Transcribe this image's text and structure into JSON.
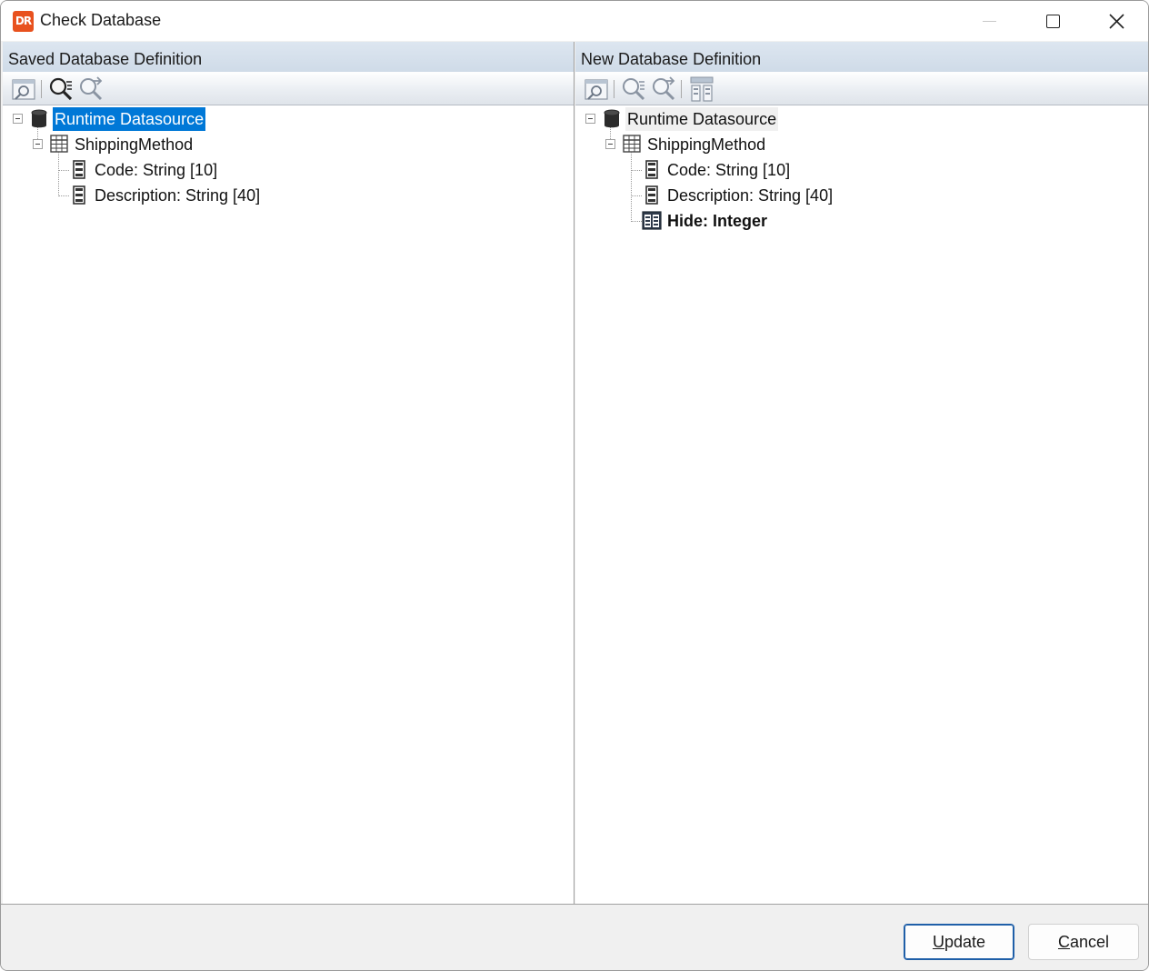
{
  "window": {
    "title": "Check Database",
    "app_icon_text": "DR",
    "controls": [
      "minimize-icon",
      "maximize-icon",
      "close-icon"
    ]
  },
  "left_pane": {
    "header": "Saved Database Definition",
    "toolbar": [
      "view-definition-icon",
      "find-icon",
      "find-next-icon"
    ],
    "tree": {
      "root": {
        "label": "Runtime Datasource",
        "icon": "database-icon",
        "state": "selected"
      },
      "table": {
        "label": "ShippingMethod",
        "icon": "table-icon"
      },
      "fields": [
        {
          "label": "Code: String [10]",
          "icon": "field-icon"
        },
        {
          "label": "Description: String [40]",
          "icon": "field-icon"
        }
      ]
    }
  },
  "right_pane": {
    "header": "New Database Definition",
    "toolbar": [
      "view-definition-icon",
      "find-icon",
      "find-next-icon",
      "compare-icon"
    ],
    "tree": {
      "root": {
        "label": "Runtime Datasource",
        "icon": "database-icon",
        "state": "focused"
      },
      "table": {
        "label": "ShippingMethod",
        "icon": "table-icon"
      },
      "fields": [
        {
          "label": "Code: String [10]",
          "icon": "field-icon"
        },
        {
          "label": "Description: String [40]",
          "icon": "field-icon"
        },
        {
          "label": "Hide: Integer",
          "icon": "new-field-icon",
          "state": "added"
        }
      ]
    }
  },
  "footer": {
    "update_label_accel": "U",
    "update_label_rest": "pdate",
    "cancel_label_accel": "C",
    "cancel_label_rest": "ancel"
  }
}
